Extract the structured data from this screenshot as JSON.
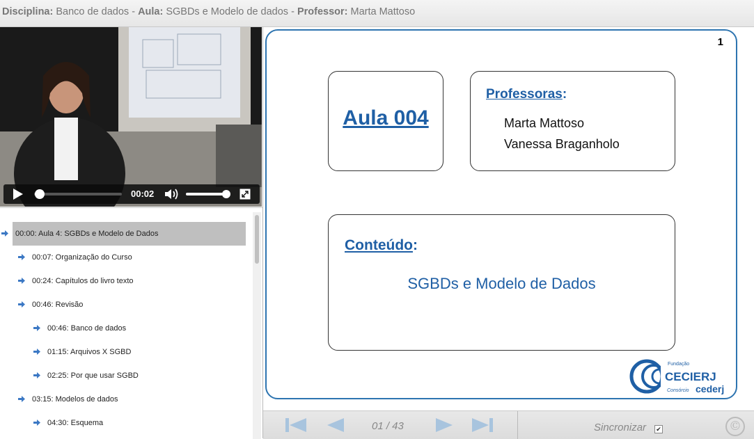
{
  "header": {
    "disciplina_label": "Disciplina:",
    "disciplina_value": "Banco de dados",
    "aula_label": "Aula:",
    "aula_value": "SGBDs e Modelo de dados",
    "professor_label": "Professor:",
    "professor_value": "Marta Mattoso",
    "separator": " -"
  },
  "video": {
    "current_time": "00:02",
    "progress_fraction": 0.02,
    "volume_fraction": 0.9,
    "icons": [
      "play-icon",
      "volume-icon",
      "fullscreen-icon"
    ]
  },
  "chapters": [
    {
      "label": "00:00: Aula 4: SGBDs e Modelo de Dados",
      "level": 0,
      "active": true
    },
    {
      "label": "00:07: Organização do Curso",
      "level": 1,
      "active": false
    },
    {
      "label": "00:24: Capítulos do livro texto",
      "level": 1,
      "active": false
    },
    {
      "label": "00:46: Revisão",
      "level": 1,
      "active": false
    },
    {
      "label": "00:46: Banco de dados",
      "level": 2,
      "active": false
    },
    {
      "label": "01:15: Arquivos X SGBD",
      "level": 2,
      "active": false
    },
    {
      "label": "02:25: Por que usar SGBD",
      "level": 2,
      "active": false
    },
    {
      "label": "03:15: Modelos de dados",
      "level": 1,
      "active": false
    },
    {
      "label": "04:30: Esquema",
      "level": 2,
      "active": false
    }
  ],
  "slide": {
    "page_number": "1",
    "aula_title": "Aula 004",
    "professoras_label": "Professoras",
    "professoras_colon": ":",
    "professoras": [
      "Marta Mattoso",
      "Vanessa Braganholo"
    ],
    "conteudo_label": "Conteúdo",
    "conteudo_colon": ":",
    "conteudo_text": "SGBDs e Modelo de Dados",
    "logo": {
      "top": "Fundação",
      "name": "CECIERJ",
      "bottom": "Consórcio",
      "brand": "cederj"
    }
  },
  "pager": {
    "label": "01 / 43",
    "sync_label": "Sincronizar",
    "sync_checked": true,
    "copyright": "©"
  },
  "colors": {
    "accent_blue": "#1f5fa5",
    "slide_border": "#2d74b0",
    "nav_arrow": "#a8c4de",
    "chapter_arrow": "#3b78c4"
  }
}
